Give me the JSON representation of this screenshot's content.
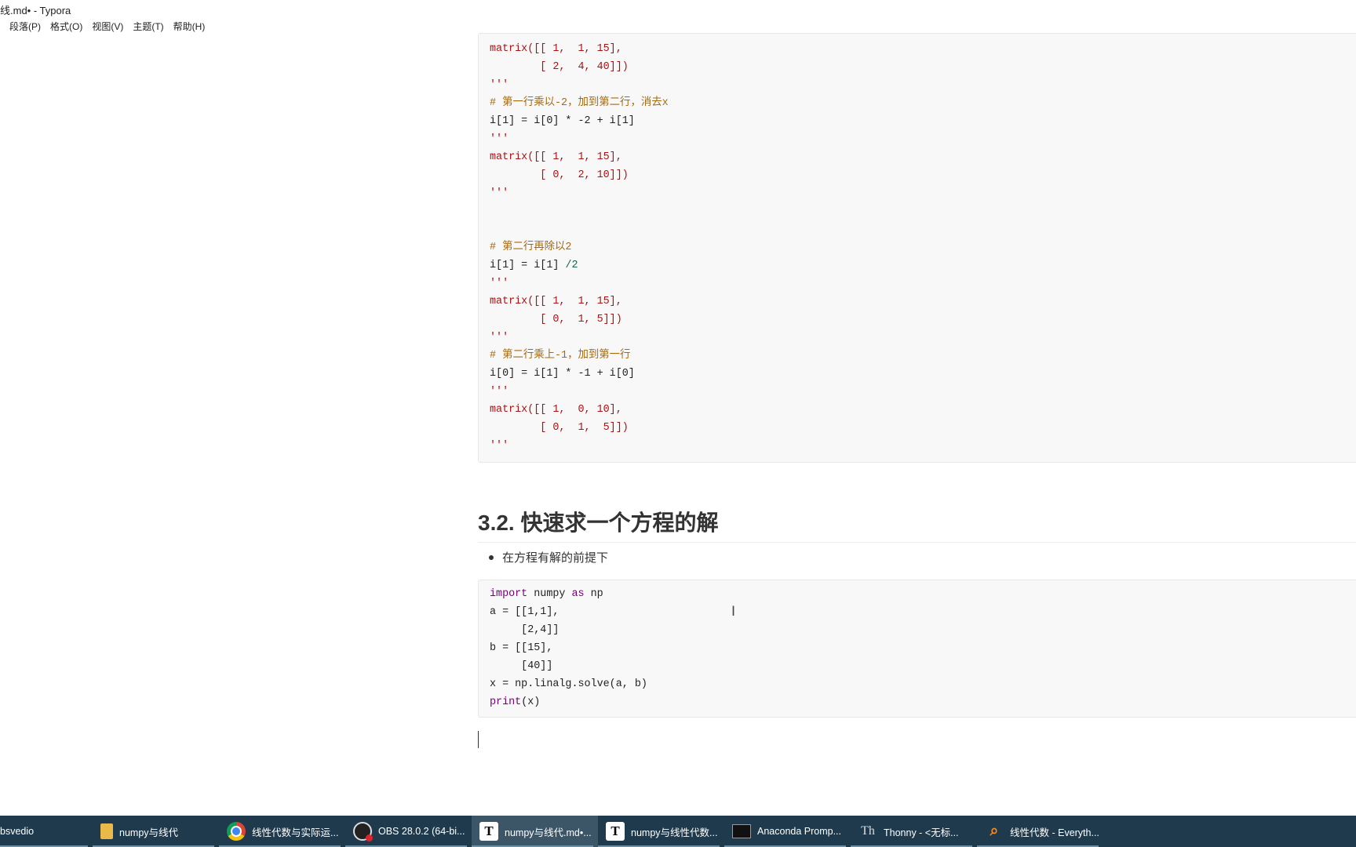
{
  "window": {
    "title": "线.md• - Typora"
  },
  "menu": [
    "段落(P)",
    "格式(O)",
    "视图(V)",
    "主题(T)",
    "帮助(H)"
  ],
  "code_block_1": {
    "lines": [
      "matrix([[ 1,  1, 15],",
      "        [ 2,  4, 40]])",
      "'''",
      "# 第一行乘以-2，加到第二行，消去x",
      "i[1] = i[0] * -2 + i[1]",
      "'''",
      "matrix([[ 1,  1, 15],",
      "        [ 0,  2, 10]])",
      "'''",
      "",
      "",
      "# 第二行再除以2",
      "i[1] = i[1] /2",
      "'''",
      "matrix([[ 1,  1, 15],",
      "        [ 0,  1, 5]])",
      "'''",
      "# 第二行乘上-1，加到第一行",
      "i[0] = i[1] * -1 + i[0]",
      "'''",
      "matrix([[ 1,  0, 10],",
      "        [ 0,  1,  5]])",
      "'''"
    ]
  },
  "section": {
    "heading": "3.2. 快速求一个方程的解",
    "bullet": "在方程有解的前提下"
  },
  "code_block_2": {
    "lines": [
      "import numpy as np",
      "a = [[1,1],",
      "     [2,4]]",
      "b = [[15],",
      "     [40]]",
      "x = np.linalg.solve(a, b)",
      "print(x)"
    ]
  },
  "taskbar": [
    {
      "label": "bsvedio",
      "icon": "none",
      "active": false
    },
    {
      "label": "numpy与线代",
      "icon": "folder-icon",
      "active": false
    },
    {
      "label": "线性代数与实际运...",
      "icon": "chrome-icon",
      "active": false
    },
    {
      "label": "OBS 28.0.2 (64-bi...",
      "icon": "obs-icon",
      "active": false
    },
    {
      "label": "numpy与线代.md•...",
      "icon": "typora-icon",
      "active": true
    },
    {
      "label": "numpy与线性代数...",
      "icon": "typora-icon",
      "active": false
    },
    {
      "label": "Anaconda Promp...",
      "icon": "terminal-icon",
      "active": false
    },
    {
      "label": "Thonny  -  <无标...",
      "icon": "thonny-icon",
      "active": false
    },
    {
      "label": "线性代数 - Everyth...",
      "icon": "search-icon",
      "active": false
    }
  ]
}
